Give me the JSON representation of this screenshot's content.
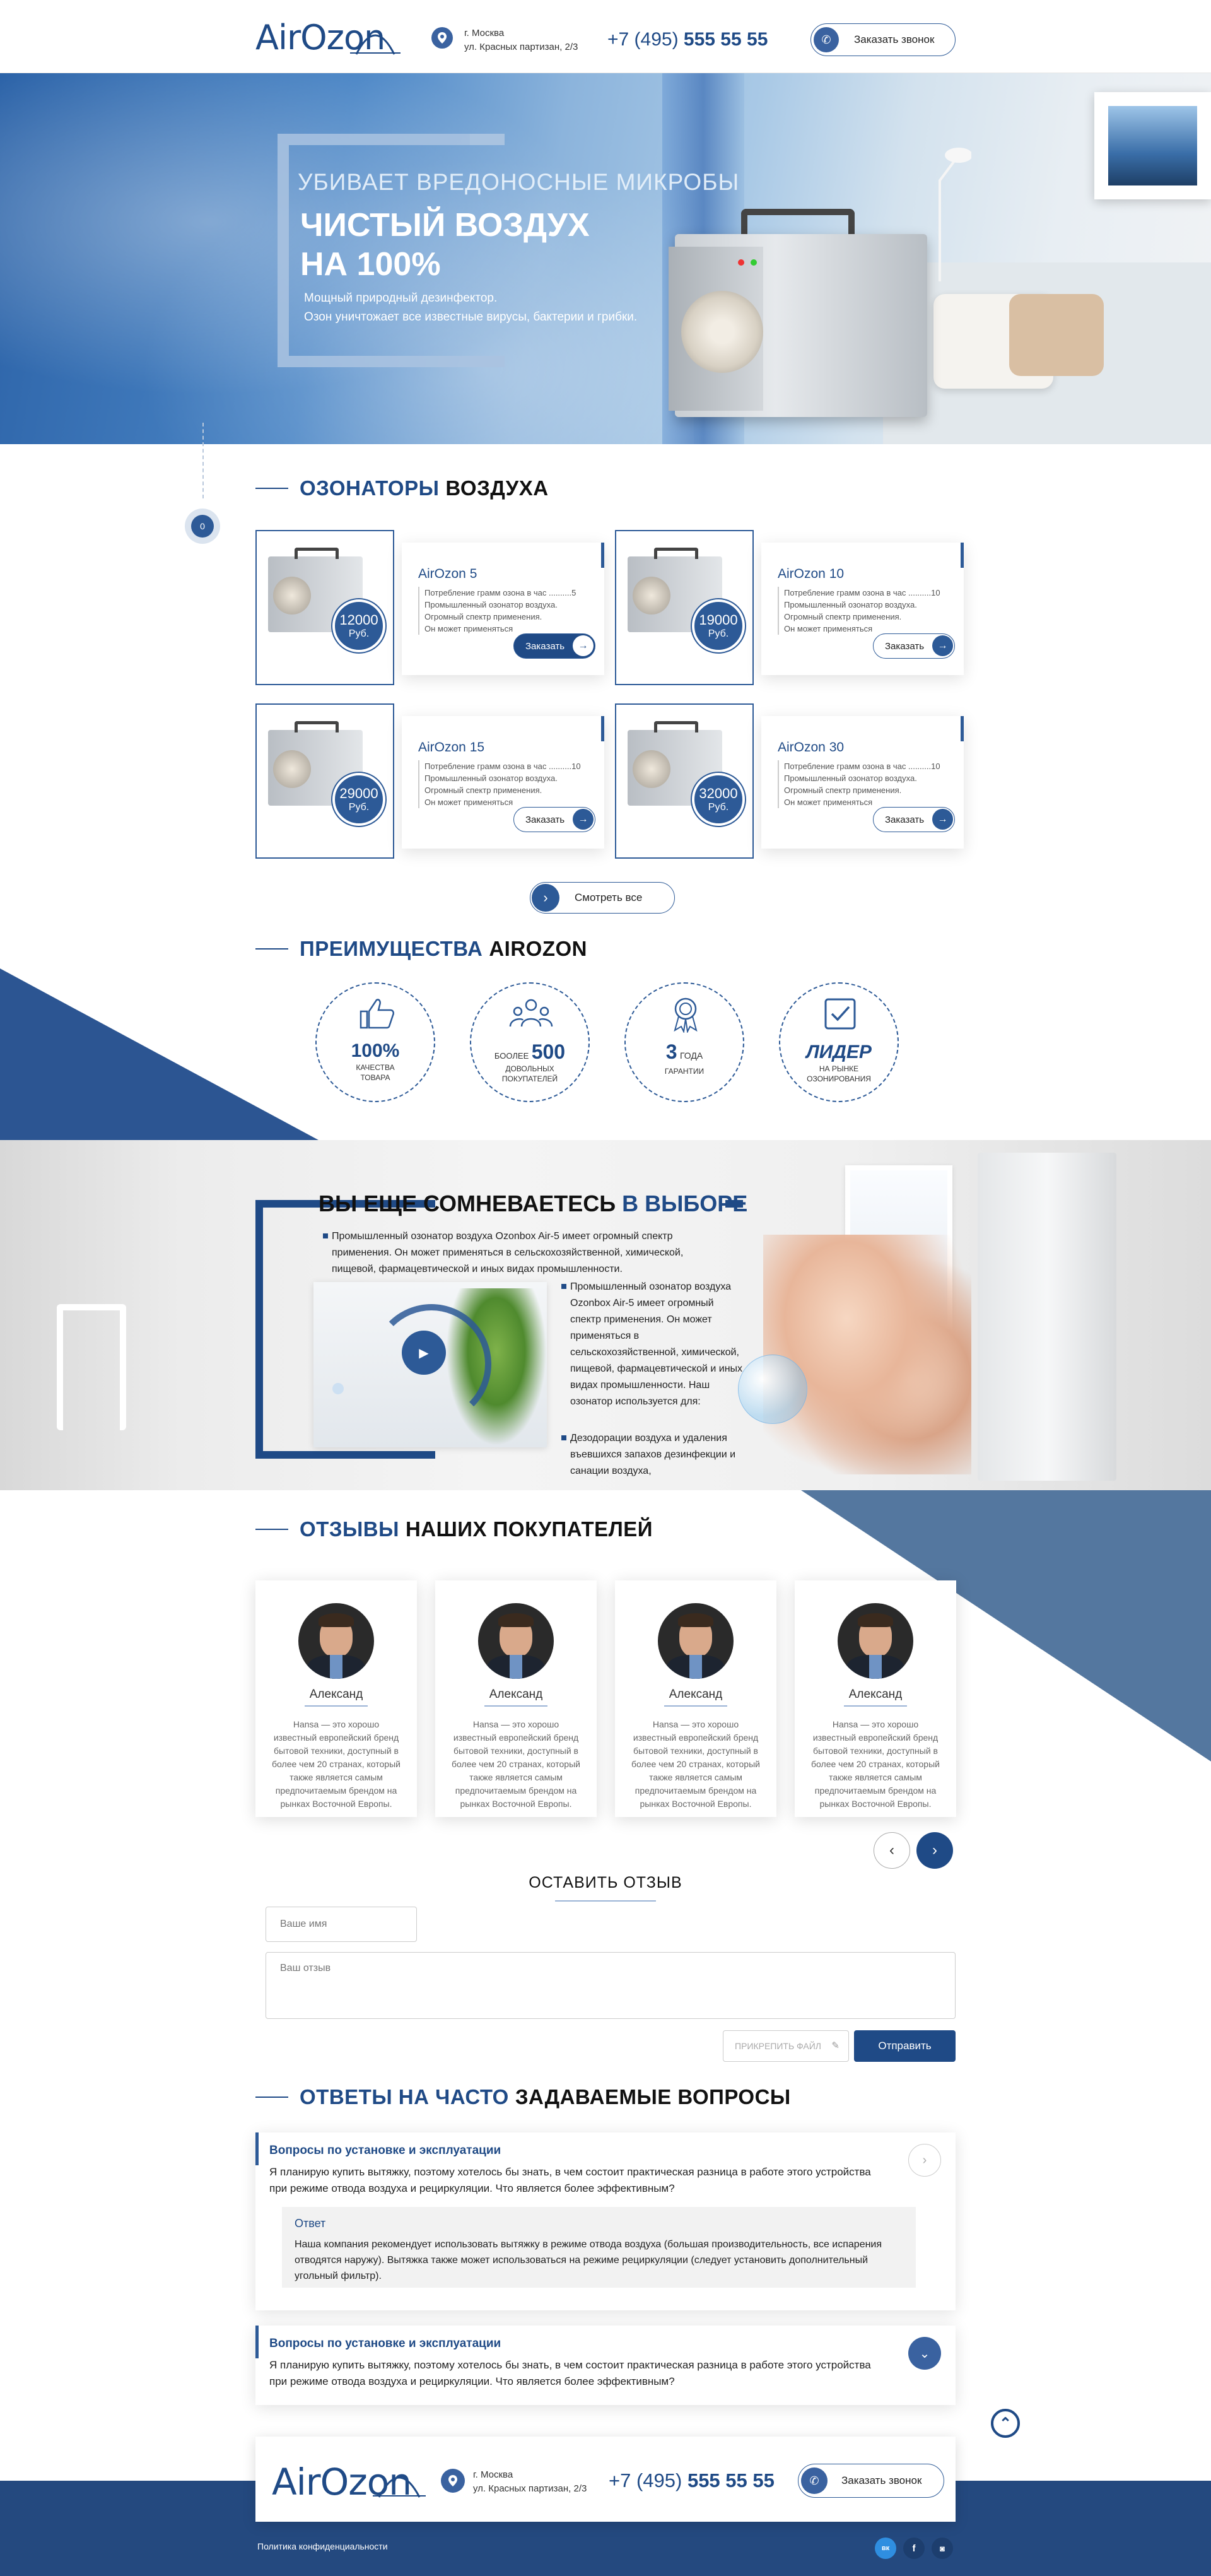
{
  "header": {
    "logo": "AirOzon",
    "city": "г. Москва",
    "street": "ул. Красных партизан, 2/3",
    "phone_prefix": "+7 (495)",
    "phone_number": "555 55 55",
    "callback_label": "Заказать звонок"
  },
  "hero": {
    "kicker": "УБИВАЕТ ВРЕДОНОСНЫЕ МИКРОБЫ",
    "title_line1": "ЧИСТЫЙ ВОЗДУХ",
    "title_line2": "НА 100%",
    "desc_line1": "Мощный природный дезинфектор.",
    "desc_line2": "Озон уничтожает  все известные вирусы, бактерии и грибки."
  },
  "side_nav": {
    "badge": "0"
  },
  "products_section": {
    "title_accent": "ОЗОНАТОРЫ",
    "title_rest": "ВОЗДУХА",
    "products": [
      {
        "name": "AirOzon 5",
        "spec1": "Потребление грамм озона в час ..........5",
        "spec2": "Промышленный озонатор воздуха.",
        "spec3": "Огромный спектр применения.",
        "spec4": "Он может применяться",
        "price": "12000",
        "currency": "Руб.",
        "order": "Заказать",
        "active": true
      },
      {
        "name": "AirOzon 10",
        "spec1": "Потребление грамм озона в час ..........10",
        "spec2": "Промышленный озонатор воздуха.",
        "spec3": "Огромный спектр применения.",
        "spec4": "Он может применяться",
        "price": "19000",
        "currency": "Руб.",
        "order": "Заказать",
        "active": false
      },
      {
        "name": "AirOzon 15",
        "spec1": "Потребление грамм озона в час ..........10",
        "spec2": "Промышленный озонатор воздуха.",
        "spec3": "Огромный спектр применения.",
        "spec4": "Он может применяться",
        "price": "29000",
        "currency": "Руб.",
        "order": "Заказать",
        "active": false
      },
      {
        "name": "AirOzon 30",
        "spec1": "Потребление грамм озона в час ..........10",
        "spec2": "Промышленный озонатор воздуха.",
        "spec3": "Огромный спектр применения.",
        "spec4": "Он может применяться",
        "price": "32000",
        "currency": "Руб.",
        "order": "Заказать",
        "active": false
      }
    ],
    "see_all": "Смотреть все"
  },
  "advantages": {
    "title_accent": "ПРЕИМУЩЕСТВА",
    "title_rest": "AIROZON",
    "items": [
      {
        "big": "100%",
        "line1": "КАЧЕСТВА",
        "line2": "ТОВАРА",
        "icon": "thumbs-up-icon"
      },
      {
        "pre": "БООЛЕЕ",
        "big": "500",
        "line1": "ДОВОЛЬНЫХ",
        "line2": "ПОКУПАТЕЛЕЙ",
        "icon": "users-icon"
      },
      {
        "big": "3",
        "post": "ГОДА",
        "line1": "ГАРАНТИИ",
        "icon": "award-icon"
      },
      {
        "big": "ЛИДЕР",
        "line1": "НА РЫНКЕ",
        "line2": "ОЗОНИРОВАНИЯ",
        "icon": "checkbox-icon"
      }
    ]
  },
  "doubt": {
    "title_dark": "ВЫ ЕЩЕ СОМНЕВАЕТЕСЬ",
    "title_accent": "В ВЫБОРЕ",
    "para1": "Промышленный озонатор воздуха Ozonbox Air-5 имеет огромный спектр применения. Он может применяться в сельскохозяйственной, химической, пищевой, фармацевтической и иных видах промышленности.",
    "para2": "Промышленный озонатор воздуха Ozonbox Air-5 имеет огромный спектр применения. Он может применяться в сельскохозяйственной, химической, пищевой, фармацевтической и иных видах промышленности. Наш озонатор используется для:",
    "para3": "Дезодорации воздуха и удаления въевшихся запахов дезинфекции и санации воздуха,"
  },
  "reviews": {
    "title_accent": "ОТЗЫВЫ",
    "title_rest": "НАШИХ ПОКУПАТЕЛЕЙ",
    "items": [
      {
        "name": "Александ",
        "text": "Hansa — это хорошо известный европейский бренд бытовой техники, доступный в более чем 20 странах, который также является самым предпочитаемым брендом на рынках Восточной Европы."
      },
      {
        "name": "Александ",
        "text": "Hansa — это хорошо известный европейский бренд бытовой техники, доступный в более чем 20 странах, который также является самым предпочитаемым брендом на рынках Восточной Европы."
      },
      {
        "name": "Александ",
        "text": "Hansa — это хорошо известный европейский бренд бытовой техники, доступный в более чем 20 странах, который также является самым предпочитаемым брендом на рынках Восточной Европы."
      },
      {
        "name": "Александ",
        "text": "Hansa — это хорошо известный европейский бренд бытовой техники, доступный в более чем 20 странах, который также является самым предпочитаемым брендом на рынках Восточной Европы."
      }
    ],
    "prev": "‹",
    "next": "›"
  },
  "review_form": {
    "title": "ОСТАВИТЬ ОТЗЫВ",
    "name_placeholder": "Ваше имя",
    "text_placeholder": "Ваш отзыв",
    "attach_label": "ПРИКРЕПИТЬ ФАЙЛ",
    "submit": "Отправить"
  },
  "faq": {
    "title_accent": "ОТВЕТЫ НА ЧАСТО",
    "title_rest": "ЗАДАВАЕМЫЕ ВОПРОСЫ",
    "items": [
      {
        "category": "Вопросы по установке и эксплуатации",
        "question": "Я планирую купить вытяжку, поэтому хотелось бы знать, в чем состоит практическая разница в работе этого устройства при режиме отвода воздуха и рециркуляции. Что является более эффективным?",
        "answer_label": "Ответ",
        "answer": "Наша компания рекомендует использовать вытяжку в режиме отвода воздуха (большая производительность, все испарения отводятся наружу). Вытяжка также может использоваться на режиме рециркуляции (следует установить дополнительный угольный фильтр)."
      },
      {
        "category": "Вопросы по установке и эксплуатации",
        "question": "Я планирую купить вытяжку, поэтому хотелось бы знать, в чем состоит практическая разница в работе этого устройства при режиме отвода воздуха и рециркуляции. Что является более эффективным?"
      }
    ]
  },
  "footer": {
    "logo": "AirOzon",
    "city": "г. Москва",
    "street": "ул. Красных партизан, 2/3",
    "phone_prefix": "+7 (495)",
    "phone_number": "555 55 55",
    "callback_label": "Заказать звонок",
    "privacy": "Политика конфиденциальности",
    "social": [
      "вк",
      "f",
      "◙"
    ]
  },
  "colors": {
    "brand": "#1f4a86",
    "brand_mid": "#2d5a97",
    "footer": "#24497f"
  }
}
